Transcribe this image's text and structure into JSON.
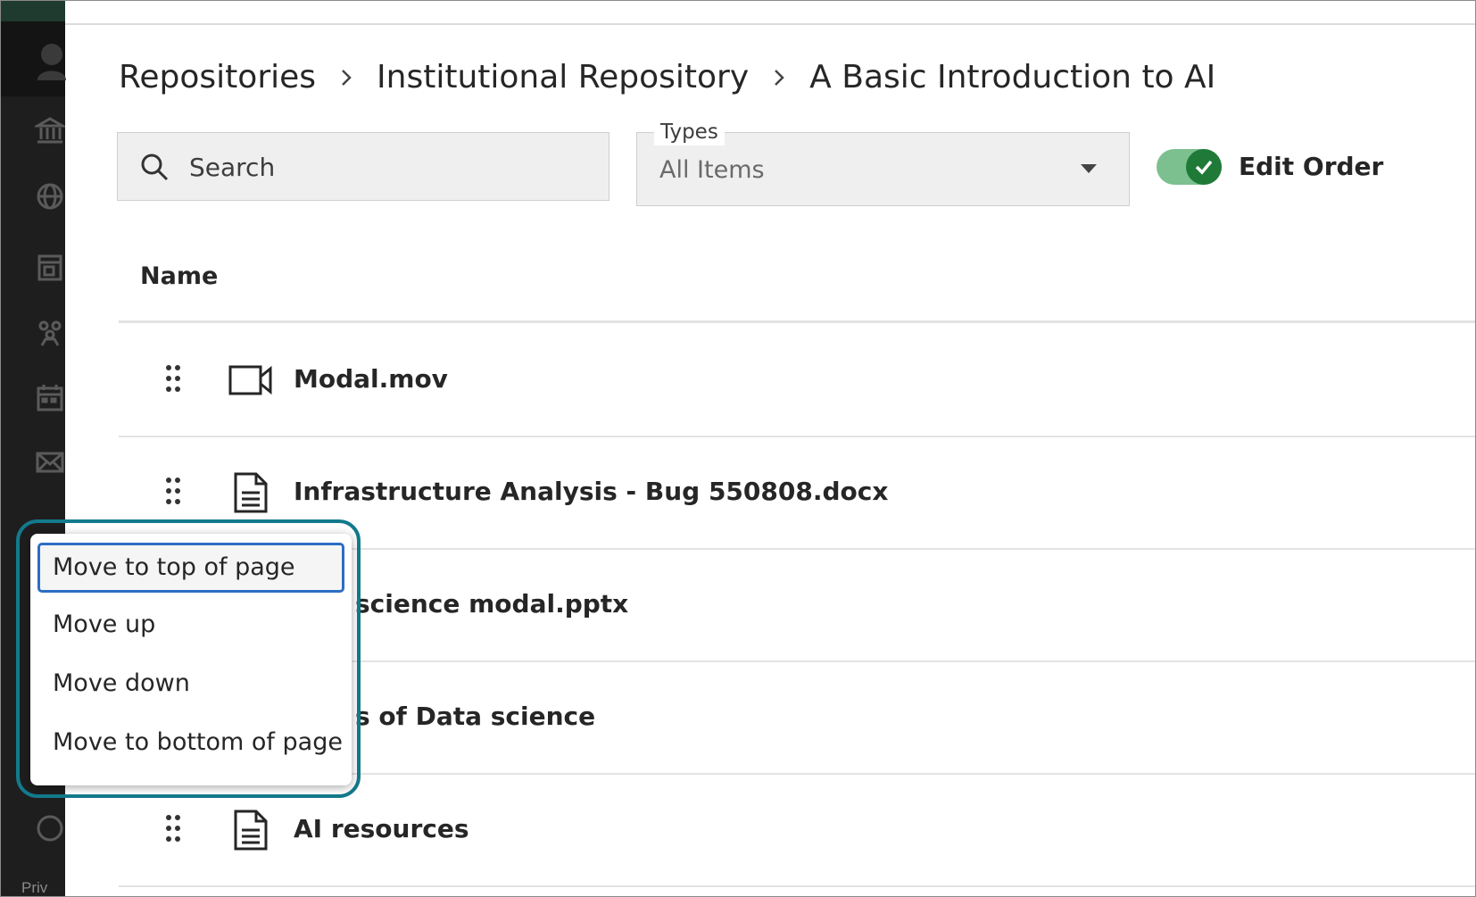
{
  "breadcrumb": {
    "items": [
      "Repositories",
      "Institutional Repository",
      "A Basic Introduction to AI"
    ]
  },
  "search": {
    "placeholder": "Search"
  },
  "types_filter": {
    "label": "Types",
    "selected": "All Items"
  },
  "edit_order": {
    "label": "Edit Order",
    "enabled": true
  },
  "table": {
    "column_name": "Name",
    "rows": [
      {
        "name": "Modal.mov",
        "icon": "video-icon"
      },
      {
        "name": "Infrastructure Analysis - Bug 550808.docx",
        "icon": "document-icon"
      },
      {
        "name": "science modal.pptx",
        "icon": "document-icon"
      },
      {
        "name": "s of Data science",
        "icon": "document-icon"
      },
      {
        "name": "AI resources",
        "icon": "document-icon"
      }
    ]
  },
  "context_menu": {
    "items": [
      "Move to top of page",
      "Move up",
      "Move down",
      "Move to bottom of page"
    ],
    "focused_index": 0
  },
  "sidebar": {
    "privacy_text": "Priv",
    "icons": [
      "avatar-icon",
      "institution-icon",
      "globe-icon",
      "courses-icon",
      "organizations-icon",
      "calendar-icon",
      "messages-icon",
      "help-icon"
    ]
  },
  "colors": {
    "sidebar_bg": "#1e1e1e",
    "toggle_track": "#7cc08f",
    "toggle_knob": "#1f7a38",
    "menu_outline": "#137a8c",
    "menu_focus": "#2d6dc4"
  }
}
